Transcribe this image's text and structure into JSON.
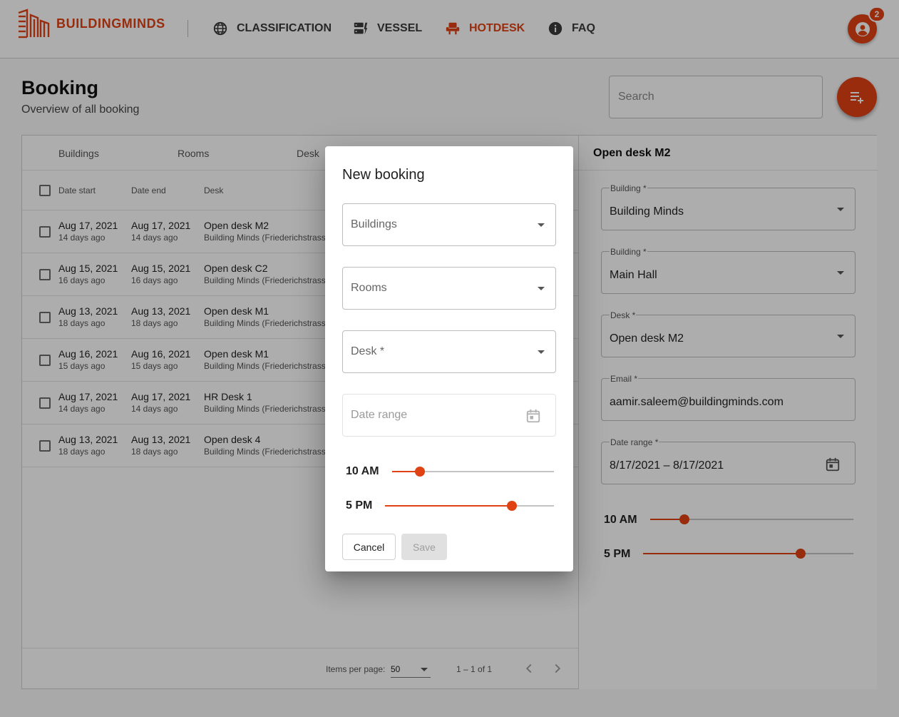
{
  "brand": {
    "name": "BUILDINGMINDS",
    "accent_color": "#e04214",
    "logo_icon": "buildingminds-logo-icon"
  },
  "nav": {
    "items": [
      {
        "label": "CLASSIFICATION",
        "icon": "globe-icon",
        "active": false
      },
      {
        "label": "VESSEL",
        "icon": "server-icon",
        "active": false
      },
      {
        "label": "HOTDESK",
        "icon": "chair-icon",
        "active": true
      },
      {
        "label": "FAQ",
        "icon": "info-icon",
        "active": false
      }
    ]
  },
  "account": {
    "icon": "account-circle-icon",
    "notification_count": "2"
  },
  "page": {
    "title": "Booking",
    "subtitle": "Overview of all booking"
  },
  "search": {
    "placeholder": "Search",
    "value": ""
  },
  "add_button": {
    "icon": "playlist-add-icon"
  },
  "filters": {
    "tabs": [
      "Buildings",
      "Rooms",
      "Desk"
    ]
  },
  "table": {
    "columns": [
      "Date start",
      "Date end",
      "Desk"
    ],
    "rows": [
      {
        "start": "Aug 17, 2021",
        "start_rel": "14 days ago",
        "end": "Aug 17, 2021",
        "end_rel": "14 days ago",
        "desk": "Open desk M2",
        "location": "Building Minds (Friederichstrasse"
      },
      {
        "start": "Aug 15, 2021",
        "start_rel": "16 days ago",
        "end": "Aug 15, 2021",
        "end_rel": "16 days ago",
        "desk": "Open desk C2",
        "location": "Building Minds (Friederichstrasse"
      },
      {
        "start": "Aug 13, 2021",
        "start_rel": "18 days ago",
        "end": "Aug 13, 2021",
        "end_rel": "18 days ago",
        "desk": "Open desk M1",
        "location": "Building Minds (Friederichstrasse"
      },
      {
        "start": "Aug 16, 2021",
        "start_rel": "15 days ago",
        "end": "Aug 16, 2021",
        "end_rel": "15 days ago",
        "desk": "Open desk M1",
        "location": "Building Minds (Friederichstrasse"
      },
      {
        "start": "Aug 17, 2021",
        "start_rel": "14 days ago",
        "end": "Aug 17, 2021",
        "end_rel": "14 days ago",
        "desk": "HR Desk 1",
        "location": "Building Minds (Friederichstrasse"
      },
      {
        "start": "Aug 13, 2021",
        "start_rel": "18 days ago",
        "end": "Aug 13, 2021",
        "end_rel": "18 days ago",
        "desk": "Open desk 4",
        "location": "Building Minds (Friederichstrasse"
      }
    ]
  },
  "paginator": {
    "items_per_page_label": "Items per page:",
    "items_per_page": "50",
    "range": "1 – 1 of 1"
  },
  "detail": {
    "title": "Open desk M2",
    "fields": [
      {
        "label": "Building *",
        "value": "Building Minds"
      },
      {
        "label": "Building *",
        "value": "Main Hall"
      },
      {
        "label": "Desk *",
        "value": "Open desk M2"
      },
      {
        "label": "Email *",
        "value": "aamir.saleem@buildingminds.com"
      },
      {
        "label": "Date range *",
        "value": "8/17/2021 – 8/17/2021"
      }
    ],
    "start_time": {
      "label": "10 AM",
      "fraction": 0.17
    },
    "end_time": {
      "label": "5 PM",
      "fraction": 0.75
    }
  },
  "dialog": {
    "title": "New booking",
    "fields": [
      {
        "placeholder": "Buildings"
      },
      {
        "placeholder": "Rooms"
      },
      {
        "placeholder": "Desk *"
      },
      {
        "placeholder": "Date range"
      }
    ],
    "start_time": {
      "label": "10 AM",
      "fraction": 0.17
    },
    "end_time": {
      "label": "5 PM",
      "fraction": 0.75
    },
    "cancel_label": "Cancel",
    "save_label": "Save"
  }
}
